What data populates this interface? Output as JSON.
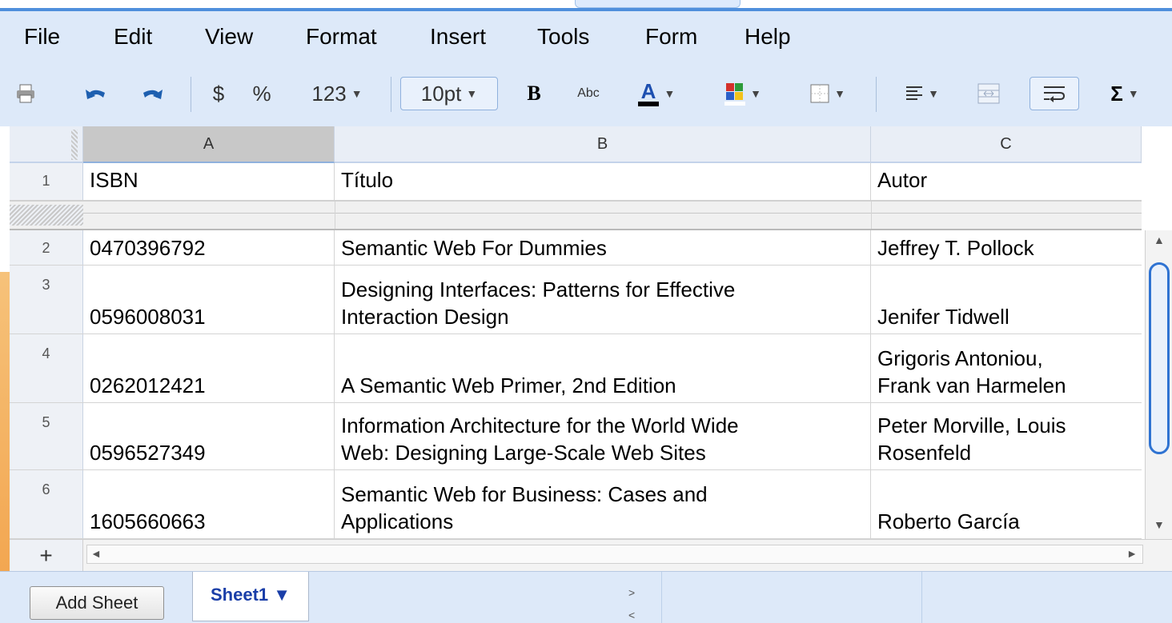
{
  "menubar": {
    "items": [
      "File",
      "Edit",
      "View",
      "Format",
      "Insert",
      "Tools",
      "Form",
      "Help"
    ]
  },
  "toolbar": {
    "currency": "$",
    "percent": "%",
    "number_format": "123",
    "font_size": "10pt",
    "bold": "B",
    "strikethrough": "Abc",
    "text_color": "A",
    "sum": "Σ"
  },
  "columns": [
    "A",
    "B",
    "C"
  ],
  "header_row": {
    "num": "1",
    "cells": [
      "ISBN",
      "Título",
      "Autor"
    ]
  },
  "rows": [
    {
      "num": "2",
      "isbn": "0470396792",
      "titulo": [
        "Semantic Web For Dummies"
      ],
      "autor": [
        "Jeffrey T. Pollock"
      ]
    },
    {
      "num": "3",
      "isbn": "0596008031",
      "titulo": [
        "Designing Interfaces: Patterns for Effective",
        "Interaction Design"
      ],
      "autor": [
        "Jenifer Tidwell"
      ]
    },
    {
      "num": "4",
      "isbn": "0262012421",
      "titulo": [
        "A Semantic Web Primer, 2nd Edition"
      ],
      "autor": [
        "Grigoris Antoniou,",
        "Frank van Harmelen"
      ]
    },
    {
      "num": "5",
      "isbn": "0596527349",
      "titulo": [
        "Information Architecture for the World Wide",
        "Web: Designing Large-Scale Web Sites"
      ],
      "autor": [
        "Peter Morville, Louis",
        "Rosenfeld"
      ]
    },
    {
      "num": "6",
      "isbn": "1605660663",
      "titulo": [
        "Semantic Web for Business: Cases and",
        "Applications"
      ],
      "autor": [
        "Roberto García"
      ]
    }
  ],
  "bottombar": {
    "add_row": "+",
    "add_sheet": "Add Sheet",
    "sheet_tab": "Sheet1 ▼"
  },
  "colors": {
    "chrome": "#dde9f9",
    "accent": "#4f8fdc",
    "sheet_tab_text": "#1a3ea8"
  }
}
